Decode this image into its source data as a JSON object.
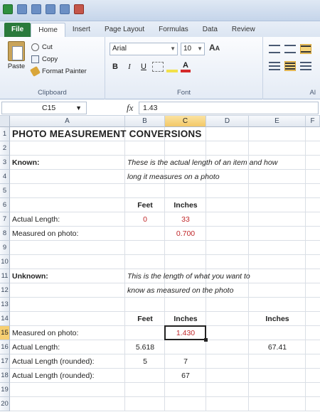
{
  "ribbon": {
    "tabs": [
      "File",
      "Home",
      "Insert",
      "Page Layout",
      "Formulas",
      "Data",
      "Review"
    ],
    "clipboard": {
      "paste": "Paste",
      "cut": "Cut",
      "copy": "Copy",
      "format_painter": "Format Painter",
      "label": "Clipboard"
    },
    "font": {
      "name": "Arial",
      "size": "10",
      "label": "Font"
    },
    "align_label": "Al"
  },
  "formula_bar": {
    "name_box": "C15",
    "fx": "fx",
    "value": "1.43"
  },
  "grid": {
    "columns": [
      "A",
      "B",
      "C",
      "D",
      "E",
      "F"
    ],
    "selected_column": "C",
    "rows": [
      "1",
      "2",
      "3",
      "4",
      "5",
      "6",
      "7",
      "8",
      "9",
      "10",
      "11",
      "12",
      "13",
      "14",
      "15",
      "16",
      "17",
      "18",
      "19",
      "20"
    ],
    "selected_row": "15",
    "cells": {
      "A1": "PHOTO MEASUREMENT CONVERSIONS",
      "A3": "Known:",
      "B3": "These is the actual length of an item and how",
      "B4": "long it measures on a photo",
      "B6": "Feet",
      "C6": "Inches",
      "A7": "Actual Length:",
      "B7": "0",
      "C7": "33",
      "A8": "Measured on photo:",
      "C8": "0.700",
      "A11": "Unknown:",
      "B11": "This is the length of what you want to",
      "B12": "know as measured on the photo",
      "B14": "Feet",
      "C14": "Inches",
      "E14": "Inches",
      "A15": "Measured on photo:",
      "C15": "1.430",
      "A16": "Actual Length:",
      "B16": "5.618",
      "E16": "67.41",
      "A17": "Actual Length (rounded):",
      "B17": "5",
      "C17": "7",
      "A18": "Actual Length (rounded):",
      "C18": "67"
    }
  }
}
